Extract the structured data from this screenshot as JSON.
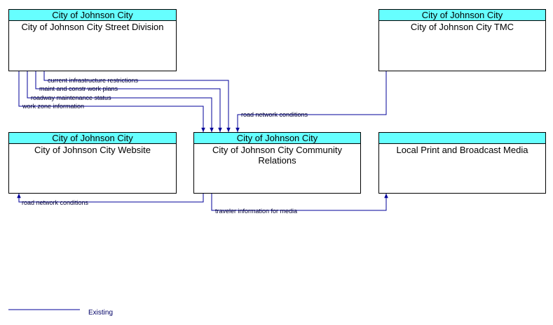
{
  "nodes": {
    "street_division": {
      "owner": "City of Johnson City",
      "name": "City of Johnson City Street Division"
    },
    "tmc": {
      "owner": "City of Johnson City",
      "name": "City of Johnson City TMC"
    },
    "website": {
      "owner": "City of Johnson City",
      "name": "City of Johnson City Website"
    },
    "community_relations": {
      "owner": "City of Johnson City",
      "name": "City of Johnson City Community Relations"
    },
    "media": {
      "owner": "",
      "name": "Local Print and Broadcast Media"
    }
  },
  "flows": {
    "current_infrastructure_restrictions": "current infrastructure restrictions",
    "maint_constr_work_plans": "maint and constr work plans",
    "roadway_maintenance_status": "roadway maintenance status",
    "work_zone_information": "work zone information",
    "road_network_conditions_tmc": "road network conditions",
    "road_network_conditions_website": "road network conditions",
    "traveler_information_for_media": "traveler information for media"
  },
  "legend": {
    "existing_label": "Existing"
  },
  "colors": {
    "flow_line": "#000099",
    "header_fill": "#66ffff"
  }
}
